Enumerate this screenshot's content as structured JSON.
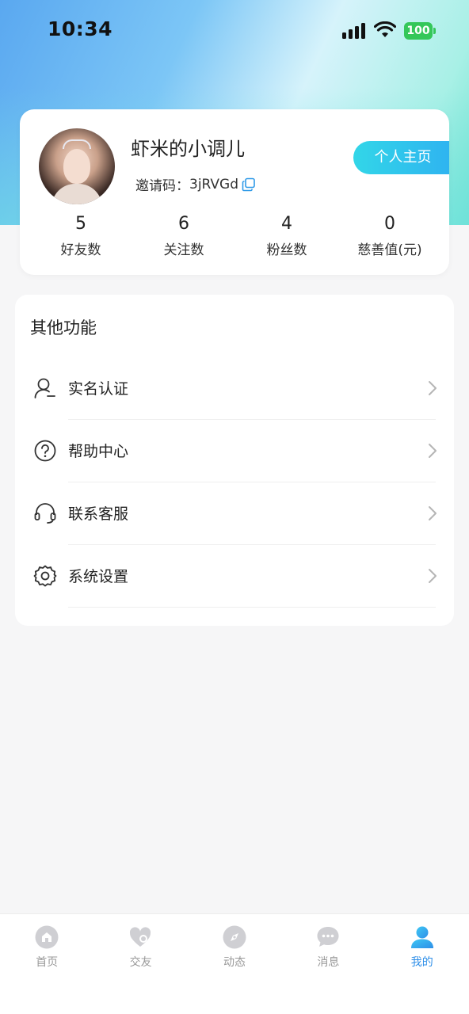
{
  "status_bar": {
    "time": "10:34",
    "battery": "100"
  },
  "profile": {
    "nickname": "虾米的小调儿",
    "invite_label": "邀请码：",
    "invite_code": "3jRVGd",
    "homepage_button": "个人主页",
    "stats": [
      {
        "value": "5",
        "label": "好友数"
      },
      {
        "value": "6",
        "label": "关注数"
      },
      {
        "value": "4",
        "label": "粉丝数"
      },
      {
        "value": "0",
        "label": "慈善值(元)"
      }
    ]
  },
  "functions": {
    "title": "其他功能",
    "items": [
      {
        "label": "实名认证",
        "icon": "user-verify-icon"
      },
      {
        "label": "帮助中心",
        "icon": "help-icon"
      },
      {
        "label": "联系客服",
        "icon": "headset-icon"
      },
      {
        "label": "系统设置",
        "icon": "gear-icon"
      }
    ]
  },
  "tabbar": {
    "active_color": "#2f8fe8",
    "inactive_color": "#cccccc",
    "items": [
      {
        "label": "首页",
        "icon": "home-icon"
      },
      {
        "label": "交友",
        "icon": "friends-icon"
      },
      {
        "label": "动态",
        "icon": "compass-icon"
      },
      {
        "label": "消息",
        "icon": "message-icon"
      },
      {
        "label": "我的",
        "icon": "profile-icon"
      }
    ]
  },
  "colors": {
    "accent": "#2fb4f0",
    "battery": "#34c759"
  }
}
